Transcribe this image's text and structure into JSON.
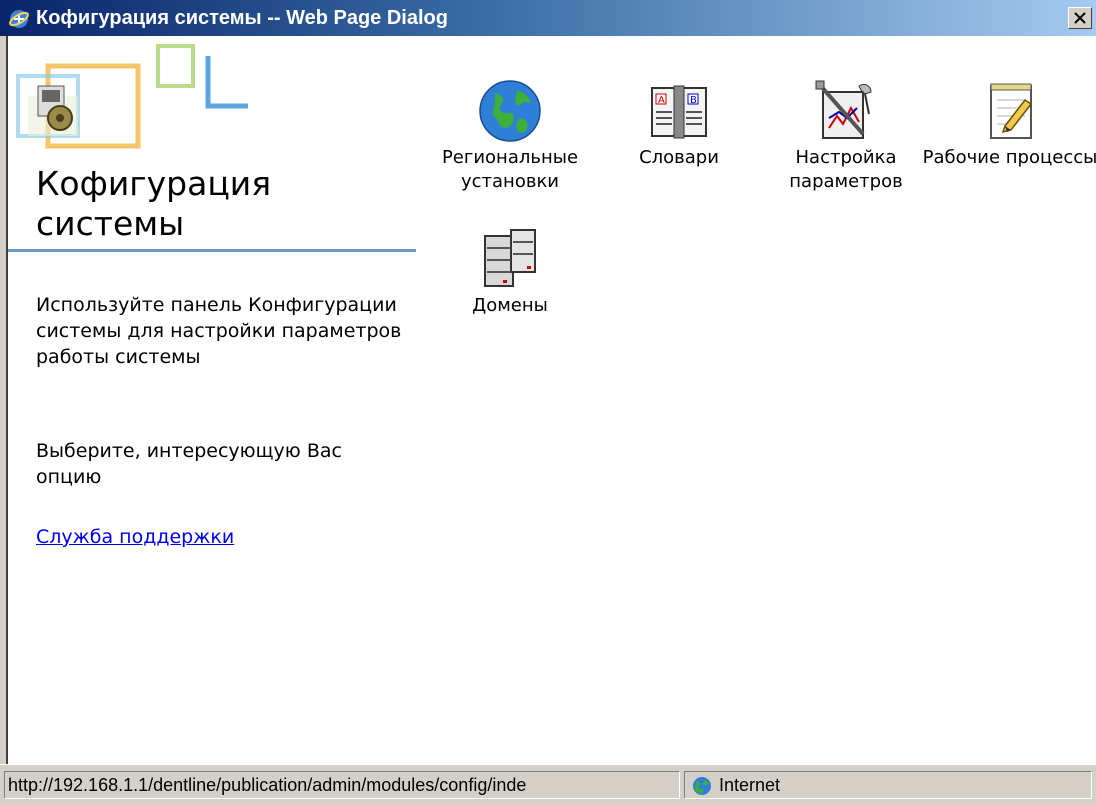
{
  "window": {
    "title": "Кофигурация системы -- Web Page Dialog"
  },
  "sidebar": {
    "panel_title": "Кофигурация системы",
    "description": "Используйте панель Конфигурации системы для настройки параметров работы системы",
    "hint": "Выберите, интересующую Вас опцию",
    "support_link": "Служба поддержки"
  },
  "items": [
    {
      "label": "Региональные установки",
      "icon": "globe-icon"
    },
    {
      "label": "Словари",
      "icon": "dictionary-book-icon"
    },
    {
      "label": "Настройка параметров",
      "icon": "settings-tools-icon"
    },
    {
      "label": "Рабочие процессы",
      "icon": "notepad-pencil-icon"
    },
    {
      "label": "Домены",
      "icon": "servers-icon"
    }
  ],
  "statusbar": {
    "url": "http://192.168.1.1/dentline/publication/admin/modules/config/inde",
    "zone": "Internet"
  },
  "colors": {
    "title_start": "#0a246a",
    "title_end": "#a6caf0",
    "divider": "#6b97c7",
    "link": "#0000ee"
  }
}
